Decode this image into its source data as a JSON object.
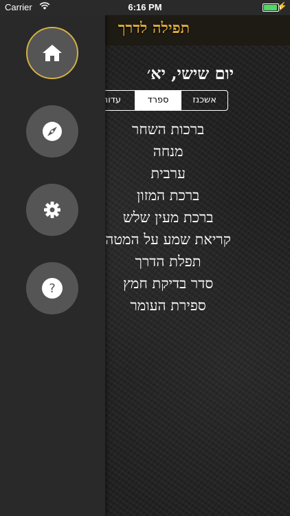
{
  "status_bar": {
    "carrier": "Carrier",
    "time": "6:16 PM",
    "battery_level": 0.85
  },
  "header": {
    "title": "תפילה לדרך"
  },
  "date_text": "יום שישי, יא׳",
  "nusach_tabs": [
    {
      "label": "אשכנז",
      "selected": false
    },
    {
      "label": "ספרד",
      "selected": true
    },
    {
      "label": "עדות",
      "selected": false
    }
  ],
  "prayers": [
    "ברכות השחר",
    "מנחה",
    "ערבית",
    "ברכת המזון",
    "ברכת מעין שלש",
    "קריאת שמע על המטה",
    "תפלת הדרך",
    "סדר בדיקת חמץ",
    "ספירת העומר"
  ],
  "menu": {
    "items": [
      {
        "icon": "home-icon",
        "active": true
      },
      {
        "icon": "compass-icon",
        "active": false
      },
      {
        "icon": "gear-icon",
        "active": false
      },
      {
        "icon": "question-icon",
        "active": false
      }
    ],
    "active_border_color": "#d4b045"
  },
  "colors": {
    "title_gold": "#d9a93a",
    "battery_green": "#4cd964"
  }
}
